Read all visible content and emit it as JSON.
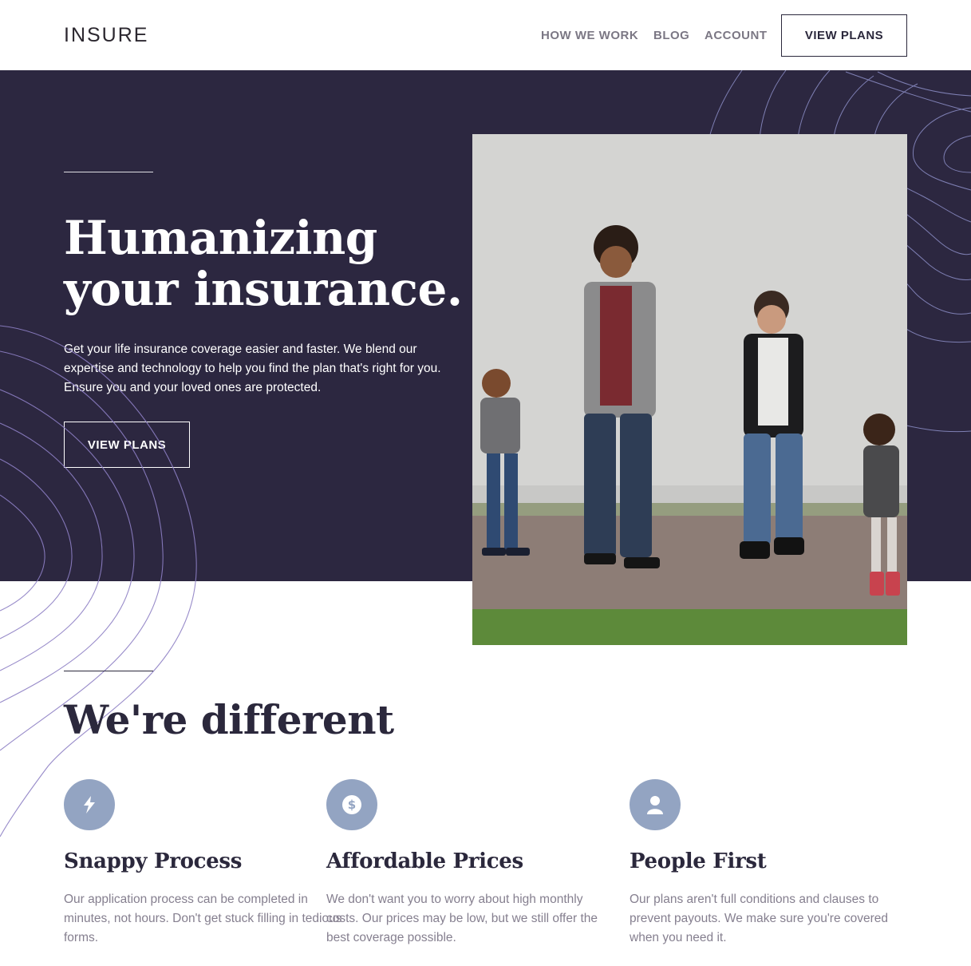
{
  "header": {
    "logo": "INSURE",
    "nav": [
      "HOW WE WORK",
      "BLOG",
      "ACCOUNT"
    ],
    "cta": "VIEW PLANS"
  },
  "hero": {
    "title_line1": "Humanizing",
    "title_line2": "your insurance.",
    "text": "Get your life insurance coverage easier and faster. We blend our expertise and technology to help you find the plan that's right for you. Ensure you and your loved ones are protected.",
    "cta": "VIEW PLANS"
  },
  "different": {
    "title": "We're different",
    "features": [
      {
        "icon": "lightning-icon",
        "title": "Snappy Process",
        "text": "Our application process can be completed in minutes, not hours. Don't get stuck filling in tedious forms."
      },
      {
        "icon": "dollar-icon",
        "title": "Affordable Prices",
        "text": "We don't want you to worry about high monthly costs. Our prices may be low, but we still offer the best coverage possible."
      },
      {
        "icon": "person-icon",
        "title": "People First",
        "text": "Our plans aren't full conditions and clauses to prevent payouts. We make sure you're covered when you need it."
      }
    ]
  },
  "colors": {
    "hero_bg": "#2c2740",
    "dark_text": "#2b283c",
    "nav_gray": "#7b7784",
    "icon_bg": "#93a4c2",
    "body_gray": "#857f8f"
  }
}
